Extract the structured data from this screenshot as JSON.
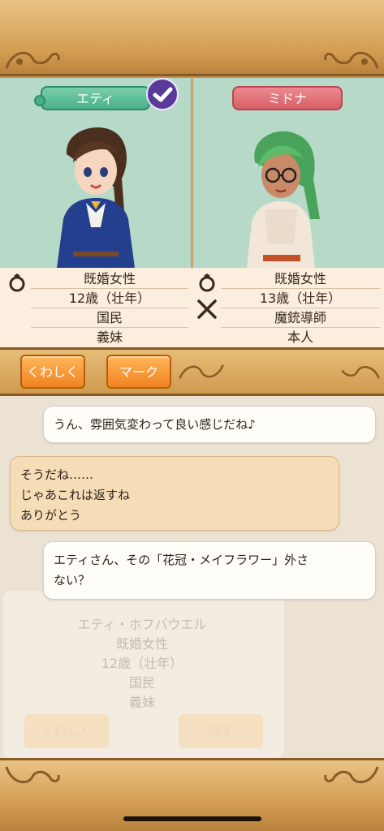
{
  "characters": {
    "left": {
      "name": "エティ",
      "status": "既婚女性",
      "age": "12歳（壮年）",
      "role": "国民",
      "relation": "義妹"
    },
    "right": {
      "name": "ミドナ",
      "status": "既婚女性",
      "age": "13歳（壮年）",
      "role": "魔銃導師",
      "relation": "本人"
    }
  },
  "buttons": {
    "details": "くわしく",
    "mark": "マーク"
  },
  "messages": [
    {
      "from": "me",
      "text": "うん、雰囲気変わって良い感じだね♪"
    },
    {
      "from": "them",
      "lines": [
        "そうだね……",
        "じゃあこれは返すね",
        "ありがとう"
      ]
    },
    {
      "from": "me",
      "lines": [
        "エティさん、その「花冠・メイフラワー」外さ",
        "ない？"
      ]
    }
  ],
  "background_card": {
    "lines": [
      "エティ・ホフバウエル",
      "既婚女性",
      "12歳（壮年）",
      "国民",
      "義妹"
    ],
    "details_button": "くわしく",
    "talk_button": "話す"
  },
  "icons": {
    "married": "ring-icon",
    "weapon": "crossed-swords-icon",
    "selected": "check-icon"
  },
  "colors": {
    "left_tag": "#4ab08a",
    "right_tag": "#d85f67",
    "button": "#f0831f",
    "panel_bg": "#b6d9c8"
  }
}
